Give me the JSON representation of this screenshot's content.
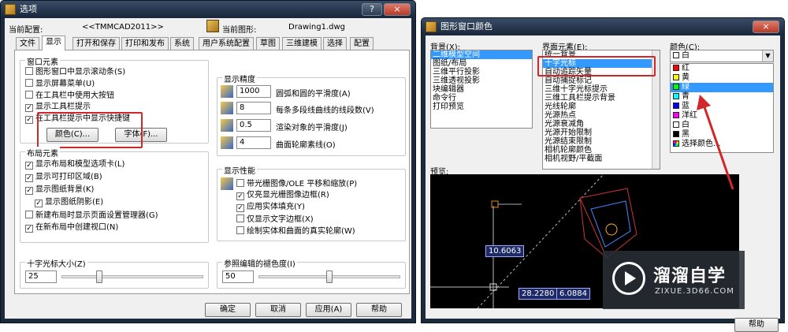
{
  "left_dialog": {
    "title": "选项",
    "help_glyph": "?",
    "close_glyph": "×",
    "current_profile_label": "当前配置:",
    "current_profile_value": "<<TMMCAD2011>>",
    "current_drawing_label": "当前图形:",
    "current_drawing_value": "Drawing1.dwg",
    "tabs": [
      "文件",
      "显示",
      "打开和保存",
      "打印和发布",
      "系统",
      "用户系统配置",
      "草图",
      "三维建模",
      "选择",
      "配置"
    ],
    "window_elements": {
      "title": "窗口元素",
      "items": [
        {
          "label": "图形窗口中显示滚动条(S)",
          "checked": false
        },
        {
          "label": "显示屏幕菜单(U)",
          "checked": false
        },
        {
          "label": "在工具栏中使用大按钮",
          "checked": false
        },
        {
          "label": "显示工具栏提示",
          "checked": true
        },
        {
          "label": "在工具栏提示中显示快捷键",
          "checked": true
        }
      ],
      "colors_button": "颜色(C)...",
      "fonts_button": "字体(F)..."
    },
    "layout_elements": {
      "title": "布局元素",
      "items": [
        {
          "label": "显示布局和模型选项卡(L)",
          "checked": true
        },
        {
          "label": "显示可打印区域(B)",
          "checked": true
        },
        {
          "label": "显示图纸背景(K)",
          "checked": true
        },
        {
          "label": "显示图纸阴影(E)",
          "checked": true
        },
        {
          "label": "新建布局时显示页面设置管理器(G)",
          "checked": false
        },
        {
          "label": "在新布局中创建视口(N)",
          "checked": true
        }
      ]
    },
    "crosshair": {
      "title": "十字光标大小(Z)",
      "value": "25",
      "level_percent": 25
    },
    "display_resolution": {
      "title": "显示精度",
      "items": [
        {
          "value": "1000",
          "label": "圆弧和圆的平滑度(A)"
        },
        {
          "value": "8",
          "label": "每条多段线曲线的线段数(V)"
        },
        {
          "value": "0.5",
          "label": "渲染对象的平滑度(J)"
        },
        {
          "value": "4",
          "label": "曲面轮廓素线(O)"
        }
      ]
    },
    "display_performance": {
      "title": "显示性能",
      "items": [
        {
          "label": "带光栅图像/OLE 平移和缩放(P)",
          "checked": false
        },
        {
          "label": "仅亮显光栅图像边框(R)",
          "checked": true
        },
        {
          "label": "应用实体填充(Y)",
          "checked": true
        },
        {
          "label": "仅显示文字边框(X)",
          "checked": false
        },
        {
          "label": "绘制实体和曲面的真实轮廓(W)",
          "checked": false
        }
      ]
    },
    "xref_fade": {
      "title": "参照编辑的褪色度(I)",
      "value": "50",
      "level_percent": 50
    },
    "buttons": {
      "ok": "确定",
      "cancel": "取消",
      "apply": "应用(A)",
      "help": "帮助"
    }
  },
  "right_dialog": {
    "title": "图形窗口颜色",
    "close_glyph": "×",
    "context_label": "背景(X):",
    "context_items": [
      "二维模型空间",
      "图纸/布局",
      "三维平行投影",
      "三维透视投影",
      "块编辑器",
      "命令行",
      "打印预览"
    ],
    "context_selected": 0,
    "interface_label": "界面元素(E):",
    "interface_items": [
      "统一背景",
      "十字光标",
      "自动追踪矢量",
      "自动捕捉标记",
      "三维十字光标提示",
      "三维工具栏提示背景",
      "光线轮廓",
      "光源热点",
      "光源衰减角",
      "光源开始限制",
      "光源结束限制",
      "相机轮廓颜色",
      "相机视野/平截面"
    ],
    "interface_selected": 1,
    "color_label": "颜色(C):",
    "color_value": "白",
    "color_options": [
      {
        "label": "红",
        "swatch": "#ff0000"
      },
      {
        "label": "黄",
        "swatch": "#ffff00"
      },
      {
        "label": "绿",
        "swatch": "#00ff00"
      },
      {
        "label": "青",
        "swatch": "#00ffff"
      },
      {
        "label": "蓝",
        "swatch": "#0000ff"
      },
      {
        "label": "洋红",
        "swatch": "#ff00ff"
      },
      {
        "label": "白",
        "swatch": "#ffffff"
      },
      {
        "label": "黑",
        "swatch": "#000000"
      },
      {
        "label": "选择颜色...",
        "swatch": "#8844cc"
      }
    ],
    "color_selected": 2,
    "preview_label": "预览:",
    "preview_readouts": [
      "10.6063",
      "28.2280",
      "6.0884"
    ],
    "help_button": "帮助"
  },
  "watermark": {
    "brand": "溜溜自学",
    "url": "ZIXUE.3D66.COM"
  },
  "colors": {
    "highlight_red": "#d0282a",
    "selection_blue": "#3399ff",
    "preview_bg": "#000000"
  }
}
